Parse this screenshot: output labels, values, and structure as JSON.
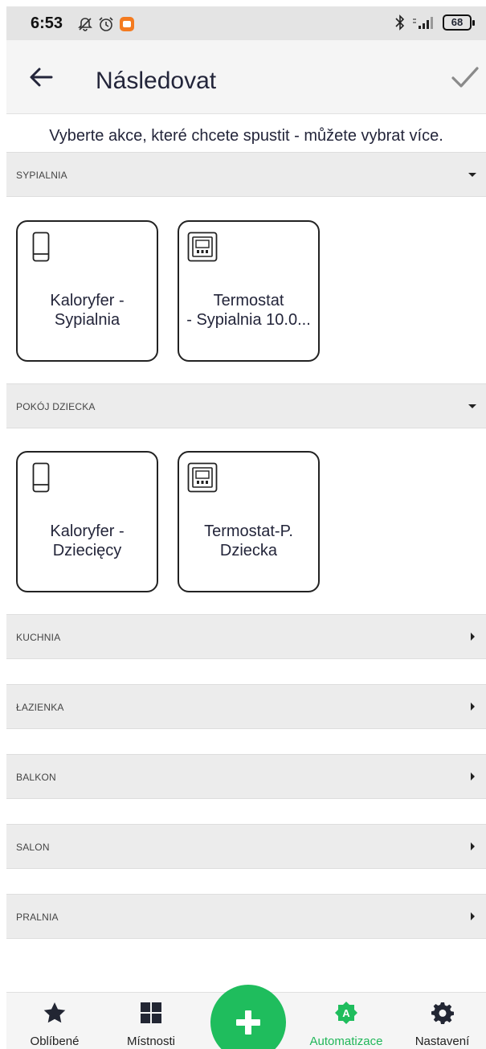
{
  "status_bar": {
    "time": "6:53",
    "battery": "68"
  },
  "header": {
    "title": "Následovat"
  },
  "subtitle": "Vyberte akce, které chcete spustit - můžete vybrat více.",
  "sections": [
    {
      "name": "SYPIALNIA",
      "expanded": true,
      "devices": [
        {
          "label": "Kaloryfer -\nSypialnia",
          "icon": "radiator-icon"
        },
        {
          "label": "Termostat\n- Sypialnia 10.0...",
          "icon": "thermostat-icon"
        }
      ]
    },
    {
      "name": "POKÓJ DZIECKA",
      "expanded": true,
      "devices": [
        {
          "label": "Kaloryfer -\nDziecięcy",
          "icon": "radiator-icon"
        },
        {
          "label": "Termostat-P.\nDziecka",
          "icon": "thermostat-icon"
        }
      ]
    },
    {
      "name": "KUCHNIA",
      "expanded": false
    },
    {
      "name": "ŁAZIENKA",
      "expanded": false
    },
    {
      "name": "BALKON",
      "expanded": false
    },
    {
      "name": "SALON",
      "expanded": false
    },
    {
      "name": "PRALNIA",
      "expanded": false
    }
  ],
  "bottom_nav": [
    {
      "label": "Oblíbené",
      "icon": "star-icon",
      "active": false
    },
    {
      "label": "Místnosti",
      "icon": "grid-icon",
      "active": false
    },
    {
      "label": "Automatizace",
      "icon": "automation-icon",
      "active": true
    },
    {
      "label": "Nastavení",
      "icon": "gear-icon",
      "active": false
    }
  ],
  "colors": {
    "accent": "#1fbd5d",
    "section_bg": "#ececec",
    "text": "#23253a"
  }
}
